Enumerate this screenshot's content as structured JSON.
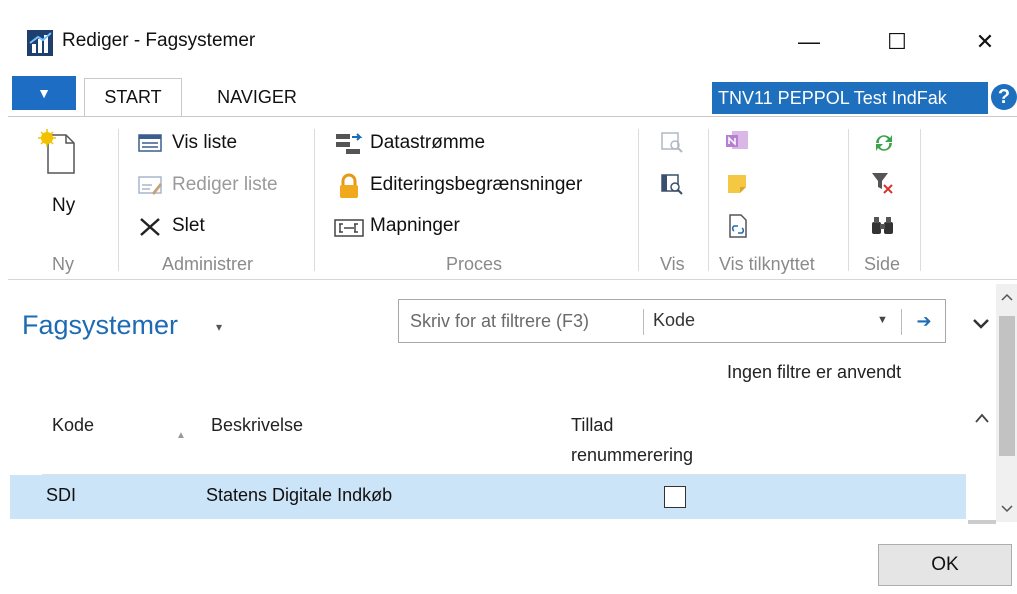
{
  "window": {
    "title": "Rediger - Fagsystemer",
    "minimize_glyph": "—",
    "maximize_glyph": "☐",
    "close_glyph": "✕"
  },
  "ribbon_tabs": {
    "menu_glyph": "▼",
    "tabs": [
      {
        "label": "START",
        "active": true
      },
      {
        "label": "NAVIGER",
        "active": false
      }
    ],
    "company": "TNV11 PEPPOL Test IndFak",
    "help_glyph": "?"
  },
  "ribbon": {
    "groups": {
      "ny": {
        "label": "Ny",
        "actions": [
          {
            "label": "Ny",
            "icon": "new-document-icon",
            "enabled": true
          }
        ]
      },
      "administrer": {
        "label": "Administrer",
        "actions": [
          {
            "label": "Vis liste",
            "icon": "list-view-icon",
            "enabled": true
          },
          {
            "label": "Rediger liste",
            "icon": "edit-list-icon",
            "enabled": false
          },
          {
            "label": "Slet",
            "icon": "delete-icon",
            "enabled": true
          }
        ]
      },
      "proces": {
        "label": "Proces",
        "actions": [
          {
            "label": "Datastrømme",
            "icon": "data-stream-icon",
            "enabled": true
          },
          {
            "label": "Editeringsbegrænsninger",
            "icon": "lock-icon",
            "enabled": true
          },
          {
            "label": "Mapninger",
            "icon": "mapping-icon",
            "enabled": true
          }
        ]
      },
      "vis": {
        "label": "Vis",
        "actions": [
          {
            "icon": "view-icon",
            "enabled": false
          },
          {
            "icon": "view-details-icon",
            "enabled": true
          }
        ]
      },
      "vis_tilknyttet": {
        "label": "Vis tilknyttet",
        "actions": [
          {
            "icon": "onenote-icon",
            "enabled": false
          },
          {
            "icon": "note-icon",
            "enabled": true
          },
          {
            "icon": "link-document-icon",
            "enabled": true
          }
        ]
      },
      "side": {
        "label": "Side",
        "actions": [
          {
            "icon": "refresh-icon",
            "enabled": true
          },
          {
            "icon": "clear-filter-icon",
            "enabled": true
          },
          {
            "icon": "find-icon",
            "enabled": true
          }
        ]
      }
    }
  },
  "page": {
    "title": "Fagsystemer",
    "title_caret": "▾",
    "filter": {
      "placeholder": "Skriv for at filtrere (F3)",
      "field": "Kode",
      "dropdown_glyph": "▼",
      "go_glyph": "➔"
    },
    "filter_status": "Ingen filtre er anvendt"
  },
  "table": {
    "columns": {
      "code": "Kode",
      "description": "Beskrivelse",
      "allow_renumbering_line1": "Tillad",
      "allow_renumbering_line2": "renummerering"
    },
    "sort_glyph": "▲",
    "rows": [
      {
        "code": "SDI",
        "description": "Statens Digitale Indkøb",
        "allow_renumbering": false
      }
    ]
  },
  "buttons": {
    "ok": "OK"
  },
  "colors": {
    "accent": "#1d6bb3",
    "company_bg": "#1e6fbe",
    "selected_row": "#cce4f7"
  }
}
